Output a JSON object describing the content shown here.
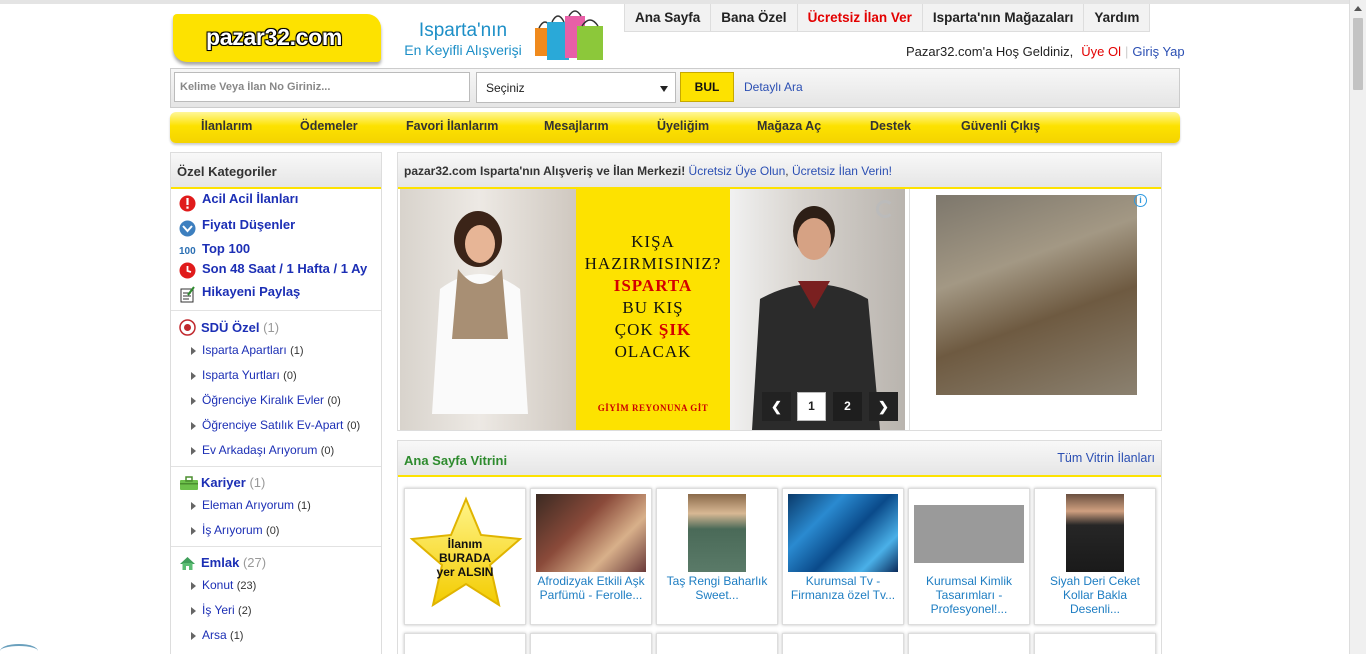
{
  "header": {
    "logo": "pazar32.com",
    "slogan_line1": "Isparta'nın",
    "slogan_line2": "En Keyifli Alışverişi"
  },
  "topnav": [
    "Ana Sayfa",
    "Bana Özel",
    "Ücretsiz İlan Ver",
    "Isparta'nın Mağazaları",
    "Yardım"
  ],
  "welcome": {
    "text": "Pazar32.com'a Hoş Geldiniz,",
    "register": "Üye Ol",
    "login": "Giriş Yap"
  },
  "search": {
    "placeholder": "Kelime Veya İlan No Giriniz...",
    "select_value": "Seçiniz",
    "button": "BUL",
    "advanced": "Detaylı Ara"
  },
  "member_menu": [
    "İlanlarım",
    "Ödemeler",
    "Favori İlanlarım",
    "Mesajlarım",
    "Üyeliğim",
    "Mağaza Aç",
    "Destek",
    "Güvenli Çıkış"
  ],
  "sidebar": {
    "title": "Özel Kategoriler",
    "special": [
      "Acil Acil İlanları",
      "Fiyatı Düşenler",
      "Top 100",
      "Son 48 Saat / 1 Hafta / 1 Ay",
      "Hikayeni Paylaş"
    ],
    "categories": [
      {
        "title": "SDÜ Özel",
        "count": "(1)",
        "items": [
          {
            "label": "Isparta Apartları",
            "count": "(1)"
          },
          {
            "label": "Isparta Yurtları",
            "count": "(0)"
          },
          {
            "label": "Öğrenciye Kiralık Evler",
            "count": "(0)"
          },
          {
            "label": "Öğrenciye Satılık Ev-Apart",
            "count": "(0)"
          },
          {
            "label": "Ev Arkadaşı Arıyorum",
            "count": "(0)"
          }
        ]
      },
      {
        "title": "Kariyer",
        "count": "(1)",
        "items": [
          {
            "label": "Eleman Arıyorum",
            "count": "(1)"
          },
          {
            "label": "İş Arıyorum",
            "count": "(0)"
          }
        ]
      },
      {
        "title": "Emlak",
        "count": "(27)",
        "items": [
          {
            "label": "Konut",
            "count": "(23)"
          },
          {
            "label": "İş Yeri",
            "count": "(2)"
          },
          {
            "label": "Arsa",
            "count": "(1)"
          }
        ]
      }
    ]
  },
  "main": {
    "intro": "pazar32.com Isparta'nın Alışveriş ve İlan Merkezi!",
    "link1": "Ücretsiz Üye Olun",
    "comma": ",",
    "link2": "Ücretsiz İlan Verin!"
  },
  "slider": {
    "lines": [
      "KIŞA",
      "HAZIRMISINIZ?",
      "ISPARTA",
      "BU KIŞ",
      "OLACAK"
    ],
    "line5_a": "ÇOK ",
    "line5_b": "ŞIK",
    "footer": "GİYİM REYONUNA GİT",
    "pages": [
      "1",
      "2"
    ]
  },
  "showcase": {
    "title": "Ana Sayfa Vitrini",
    "all_link": "Tüm Vitrin İlanları",
    "star_lines": [
      "İlanım",
      "BURADA",
      "yer ALSIN"
    ],
    "items": [
      "Afrodizyak Etkili Aşk Parfümü - Ferolle...",
      "Taş Rengi Baharlık Sweet...",
      "Kurumsal Tv - Firmanıza özel Tv...",
      "Kurumsal Kimlik Tasarımları - Profesyonel!...",
      "Siyah Deri Ceket Kollar Bakla Desenli..."
    ]
  },
  "colors": {
    "brand_yellow": "#fde200",
    "link_blue": "#2b4fb3",
    "alert_red": "#e30000",
    "showcase_green": "#2e8b2e"
  }
}
